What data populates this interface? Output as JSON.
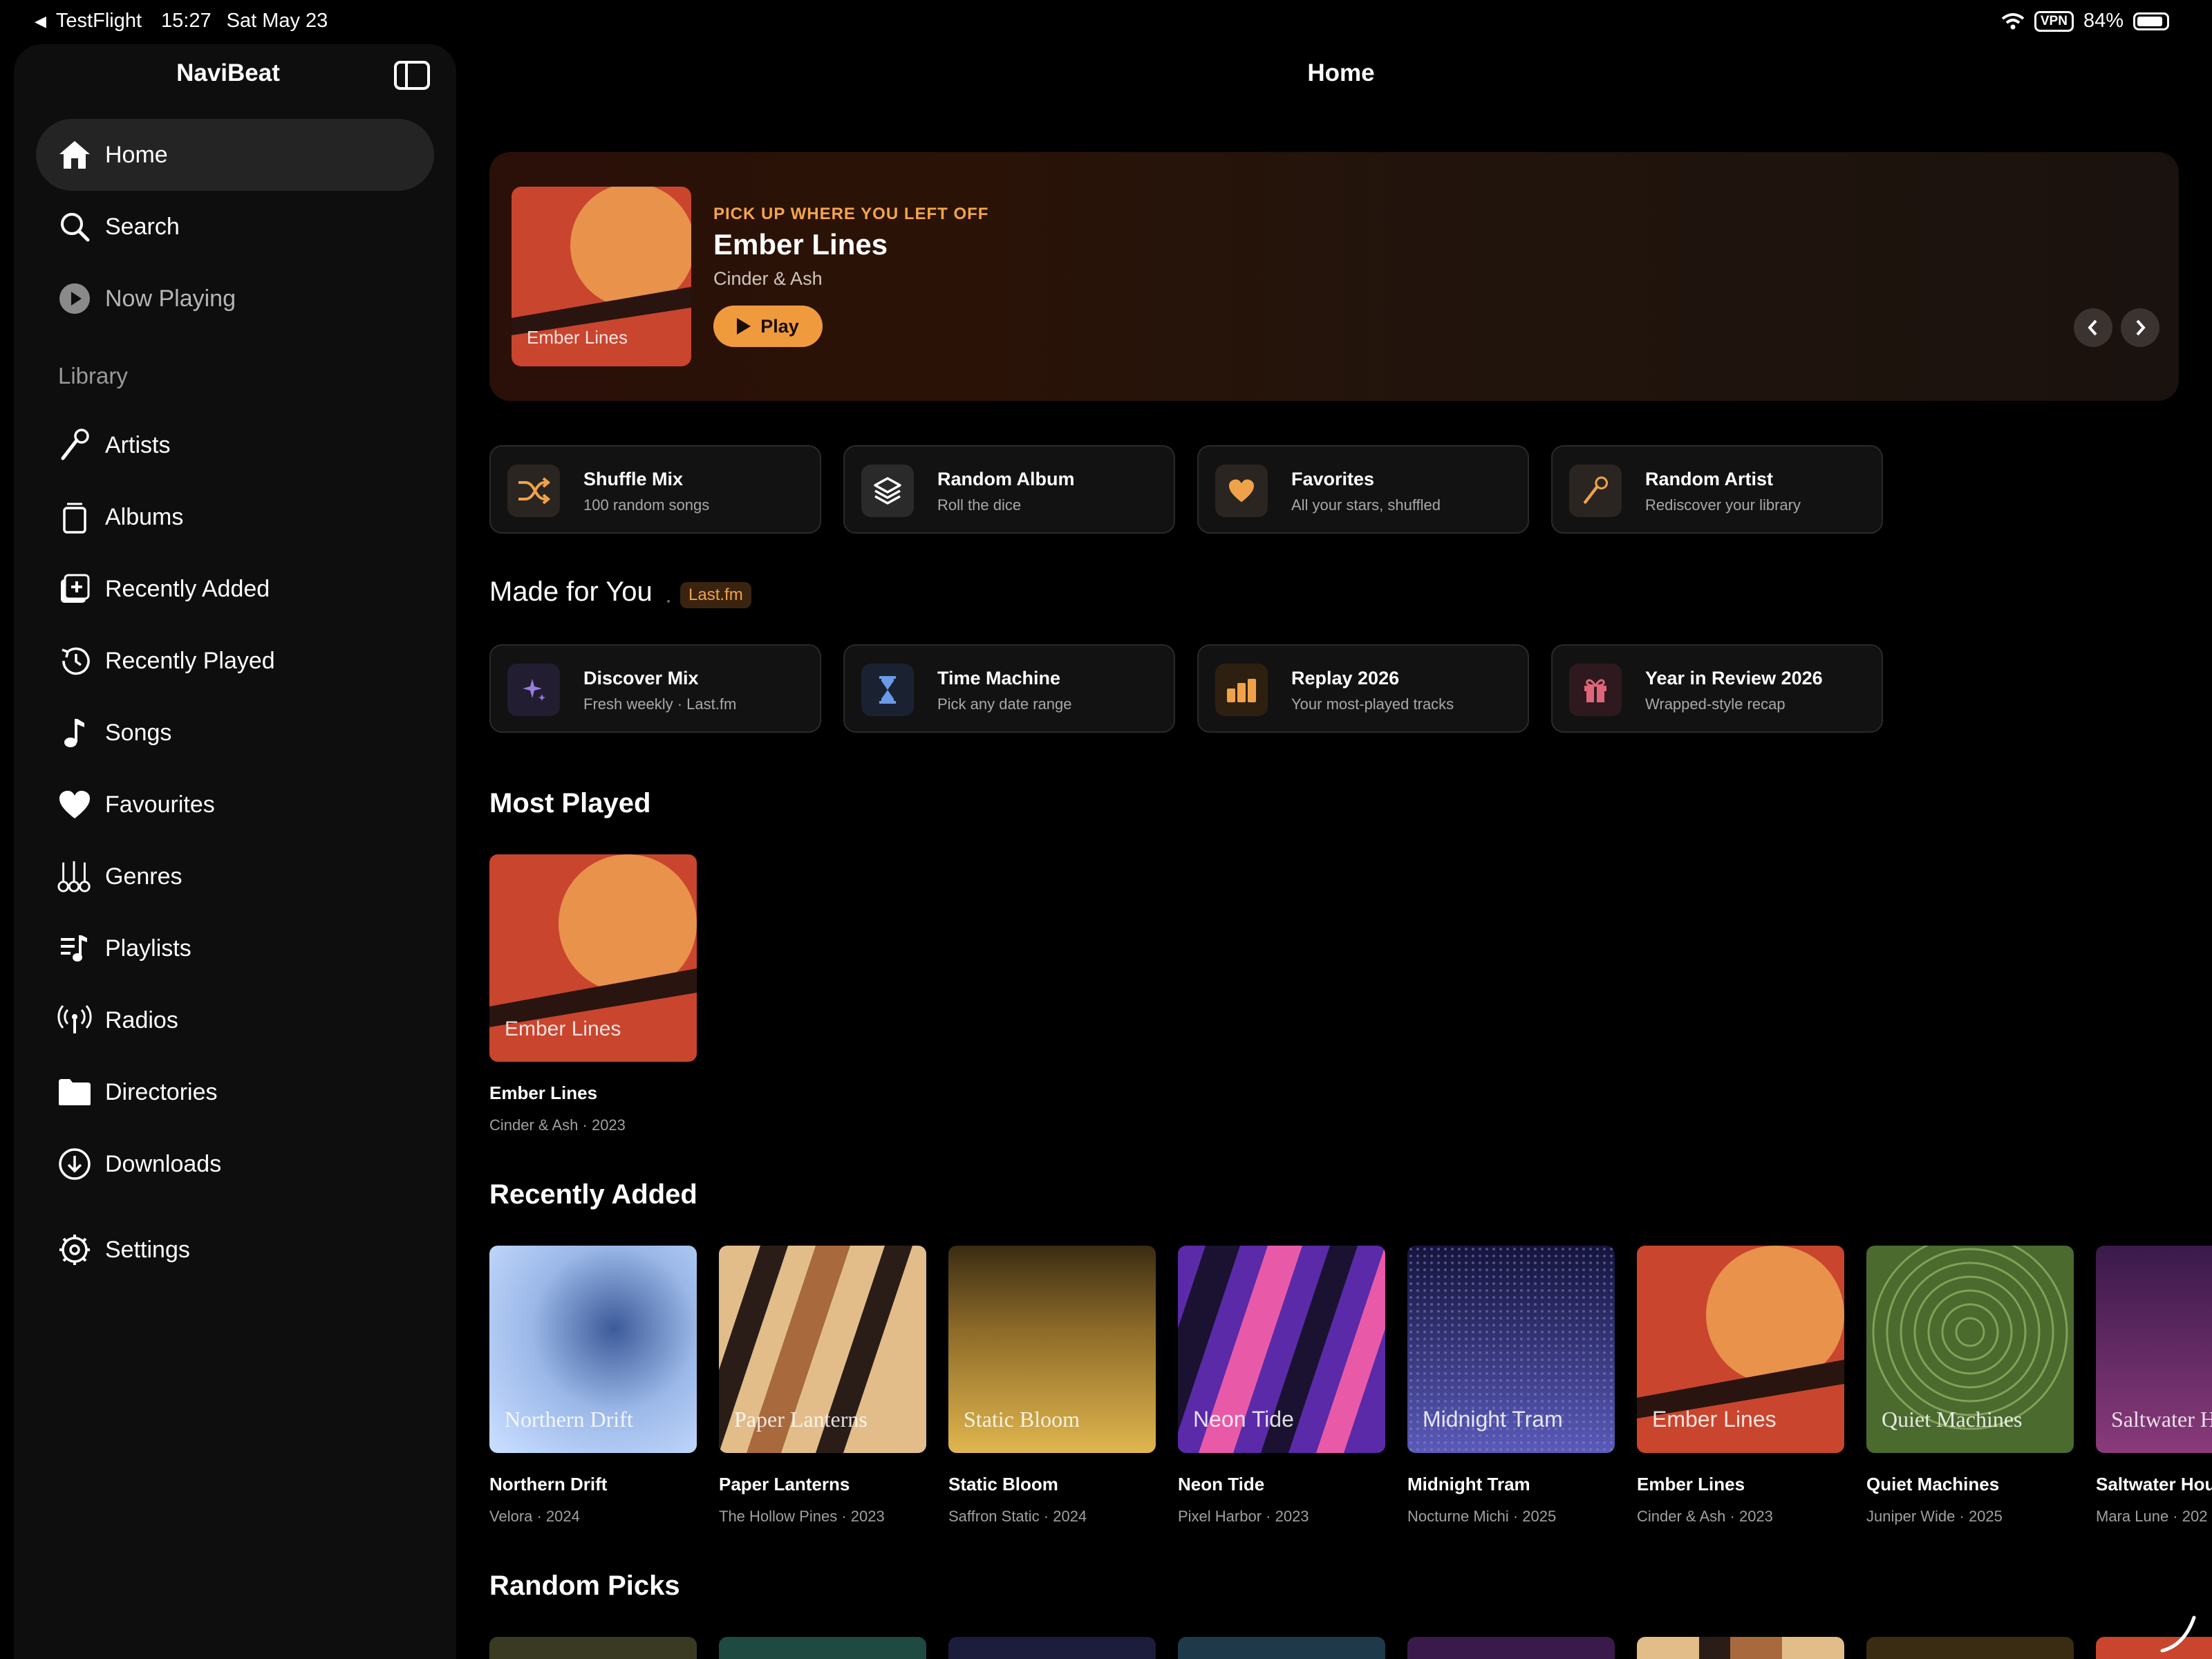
{
  "status_bar": {
    "back_app": "TestFlight",
    "time": "15:27",
    "date": "Sat May 23",
    "vpn": "VPN",
    "battery": "84%"
  },
  "sidebar": {
    "app_title": "NaviBeat",
    "top_items": [
      {
        "label": "Home",
        "icon": "house-icon",
        "active": true
      },
      {
        "label": "Search",
        "icon": "magnifier-icon"
      },
      {
        "label": "Now Playing",
        "icon": "play-circle-icon"
      }
    ],
    "library_heading": "Library",
    "library_items": [
      {
        "label": "Artists",
        "icon": "microphone-icon"
      },
      {
        "label": "Albums",
        "icon": "album-stack-icon"
      },
      {
        "label": "Recently Added",
        "icon": "recently-added-icon"
      },
      {
        "label": "Recently Played",
        "icon": "history-icon"
      },
      {
        "label": "Songs",
        "icon": "music-note-icon"
      },
      {
        "label": "Favourites",
        "icon": "heart-icon"
      },
      {
        "label": "Genres",
        "icon": "guitars-icon"
      },
      {
        "label": "Playlists",
        "icon": "playlist-icon"
      },
      {
        "label": "Radios",
        "icon": "antenna-icon"
      },
      {
        "label": "Directories",
        "icon": "folder-icon"
      },
      {
        "label": "Downloads",
        "icon": "download-icon"
      },
      {
        "label": "Settings",
        "icon": "gear-icon"
      }
    ]
  },
  "main": {
    "page_title": "Home",
    "hero": {
      "kicker": "PICK UP WHERE YOU LEFT OFF",
      "title": "Ember Lines",
      "artist": "Cinder & Ash",
      "play_label": "Play",
      "art_label": "Ember Lines"
    },
    "quick_actions": [
      {
        "title": "Shuffle Mix",
        "subtitle": "100 random songs",
        "icon": "shuffle-icon"
      },
      {
        "title": "Random Album",
        "subtitle": "Roll the dice",
        "icon": "layers-icon"
      },
      {
        "title": "Favorites",
        "subtitle": "All your stars, shuffled",
        "icon": "heart-icon"
      },
      {
        "title": "Random Artist",
        "subtitle": "Rediscover your library",
        "icon": "microphone-icon"
      }
    ],
    "made_for_you": {
      "title": "Made for You",
      "separator": "·",
      "badge": "Last.fm",
      "cards": [
        {
          "title": "Discover Mix",
          "subtitle": "Fresh weekly · Last.fm",
          "icon": "sparkle-icon"
        },
        {
          "title": "Time Machine",
          "subtitle": "Pick any date range",
          "icon": "hourglass-icon"
        },
        {
          "title": "Replay 2026",
          "subtitle": "Your most-played tracks",
          "icon": "bar-chart-icon"
        },
        {
          "title": "Year in Review 2026",
          "subtitle": "Wrapped-style recap",
          "icon": "gift-icon"
        }
      ]
    },
    "most_played": {
      "title": "Most Played",
      "albums": [
        {
          "title": "Ember Lines",
          "subtitle": "Cinder & Ash · 2023"
        }
      ]
    },
    "recently_added": {
      "title": "Recently Added",
      "albums": [
        {
          "title": "Northern Drift",
          "subtitle": "Velora · 2024"
        },
        {
          "title": "Paper Lanterns",
          "subtitle": "The Hollow Pines · 2023"
        },
        {
          "title": "Static Bloom",
          "subtitle": "Saffron Static · 2024"
        },
        {
          "title": "Neon Tide",
          "subtitle": "Pixel Harbor · 2023"
        },
        {
          "title": "Midnight Tram",
          "subtitle": "Nocturne Michi · 2025"
        },
        {
          "title": "Ember Lines",
          "subtitle": "Cinder & Ash · 2023"
        },
        {
          "title": "Quiet Machines",
          "subtitle": "Juniper Wide · 2025"
        },
        {
          "title": "Saltwater Hou",
          "subtitle": "Mara Lune · 202"
        }
      ]
    },
    "random_picks": {
      "title": "Random Picks"
    }
  }
}
